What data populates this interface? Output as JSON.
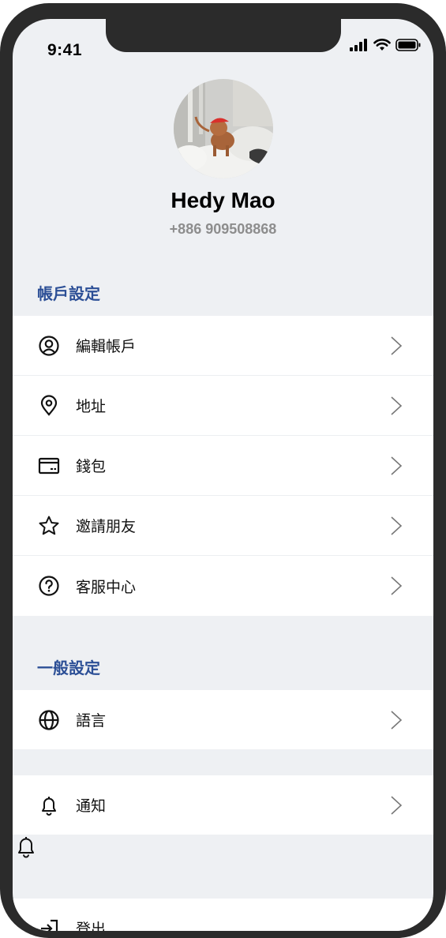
{
  "status_bar": {
    "time": "9:41",
    "icons": [
      "signal-icon",
      "wifi-icon",
      "battery-icon"
    ]
  },
  "profile": {
    "name": "Hedy Mao",
    "phone": "+886 909508868"
  },
  "sections": {
    "account": {
      "title": "帳戶設定",
      "items": [
        {
          "label": "編輯帳戶",
          "icon": "user-circle-icon"
        },
        {
          "label": "地址",
          "icon": "location-pin-icon"
        },
        {
          "label": "錢包",
          "icon": "wallet-card-icon"
        },
        {
          "label": "邀請朋友",
          "icon": "star-icon"
        },
        {
          "label": "客服中心",
          "icon": "help-circle-icon"
        }
      ]
    },
    "general": {
      "title": "一般設定",
      "language": {
        "label": "語言",
        "icon": "globe-icon"
      },
      "notification": {
        "label": "通知",
        "icon": "bell-icon"
      }
    },
    "logout": {
      "label": "登出",
      "icon": "logout-icon"
    }
  },
  "colors": {
    "accent": "#2c4f96",
    "background": "#eef0f3",
    "frame": "#2b2b2b"
  }
}
